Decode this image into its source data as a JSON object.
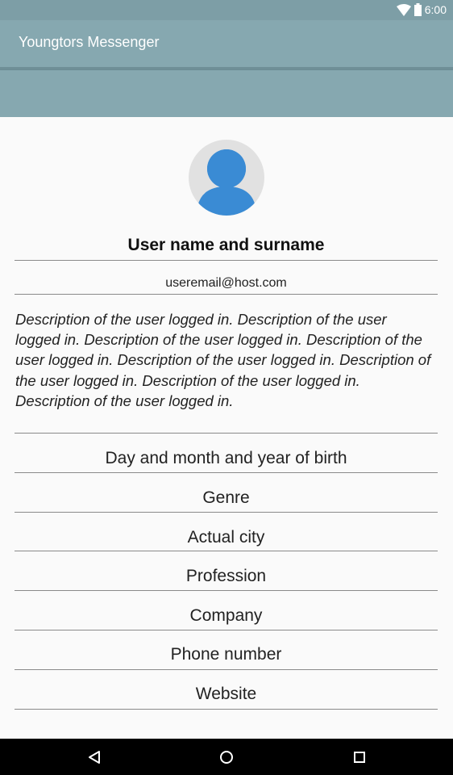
{
  "status_bar": {
    "time": "6:00",
    "icons": [
      "wifi-icon",
      "battery-icon"
    ]
  },
  "app_bar": {
    "title": "Youngtors Messenger"
  },
  "profile": {
    "avatar_icon": "user-avatar-icon",
    "name": "User name and surname",
    "email": "useremail@host.com",
    "description": "Description of the user logged in. Description of the user logged in. Description of the user logged in. Description of the user logged in. Description of the user logged in. Description of the user logged in. Description of the user logged in. Description of the user logged in."
  },
  "fields": [
    {
      "label": "Day and month and year of birth"
    },
    {
      "label": "Genre"
    },
    {
      "label": "Actual city"
    },
    {
      "label": "Profession"
    },
    {
      "label": "Company"
    },
    {
      "label": "Phone number"
    },
    {
      "label": "Website"
    }
  ],
  "nav_bar": {
    "buttons": [
      "back-icon",
      "home-icon",
      "recents-icon"
    ]
  },
  "colors": {
    "app_bar": "#86a8b0",
    "status_bar": "#7d9ea6",
    "avatar_figure": "#3a8bd4",
    "avatar_background": "#e1e1e1"
  }
}
